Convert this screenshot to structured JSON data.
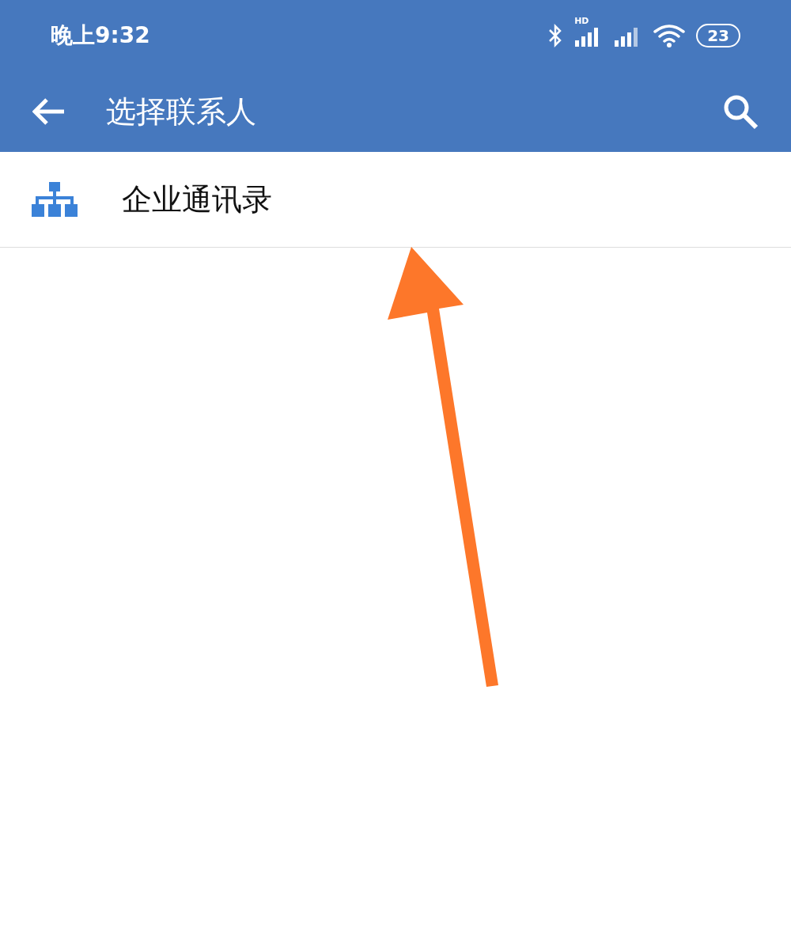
{
  "status_bar": {
    "time": "晚上9:32",
    "network_label": "HD",
    "battery": "23"
  },
  "toolbar": {
    "title": "选择联系人"
  },
  "list": [
    {
      "label": "企业通讯录"
    }
  ]
}
